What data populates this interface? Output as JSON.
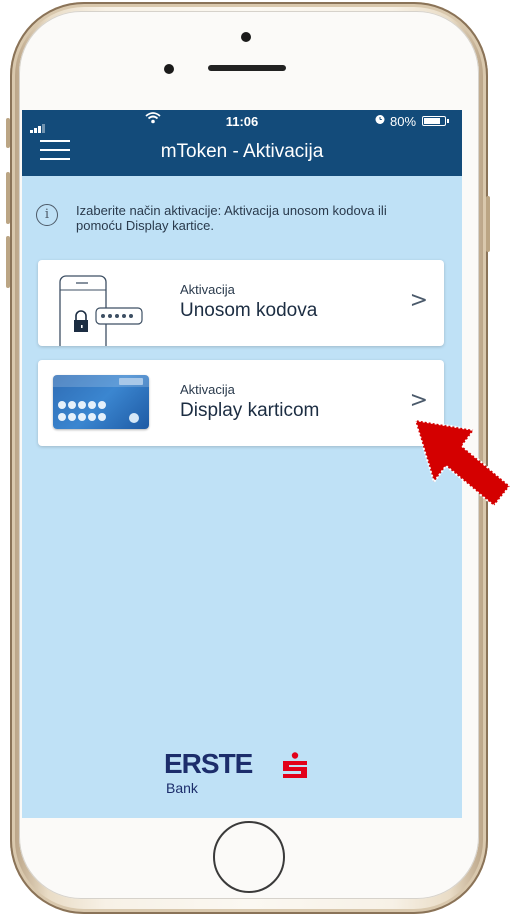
{
  "status_bar": {
    "time": "11:06",
    "battery": "80%"
  },
  "header": {
    "title": "mToken - Aktivacija"
  },
  "info": {
    "text": "Izaberite način aktivacije: Aktivacija unosom kodova ili pomoću Display kartice."
  },
  "options": [
    {
      "small": "Aktivacija",
      "big": "Unosom kodova",
      "icon": "phone-lock-codes-icon"
    },
    {
      "small": "Aktivacija",
      "big": "Display karticom",
      "icon": "display-card-icon"
    }
  ],
  "footer": {
    "logo_text": "ERSTE",
    "logo_sub": "Bank"
  },
  "colors": {
    "header": "#134b7a",
    "screen_bg": "#bfe1f6",
    "arrow": "#d40000",
    "logo_red": "#e2001a",
    "logo_blue": "#1c2d6b"
  }
}
